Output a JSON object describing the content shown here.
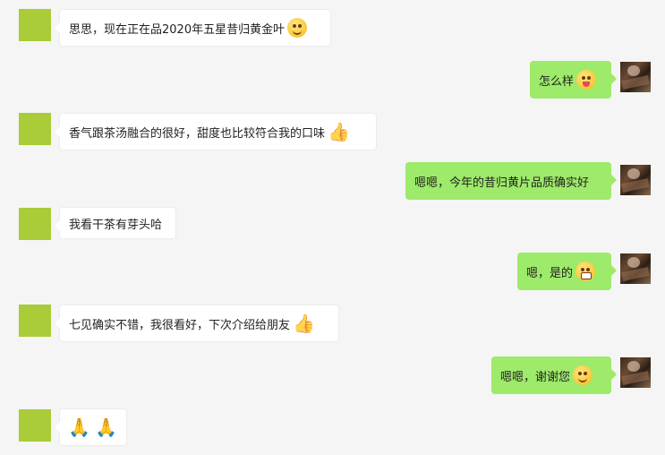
{
  "messages": [
    {
      "side": "left",
      "text": "思思，现在正在品2020年五星昔归黄金叶",
      "emoji": "thinking-face-icon"
    },
    {
      "side": "right",
      "text": "怎么样",
      "emoji": "crazy-face-icon"
    },
    {
      "side": "left",
      "text": "香气跟茶汤融合的很好，甜度也比较符合我的口味",
      "emoji": "thumbs-up-icon"
    },
    {
      "side": "right",
      "text": "嗯嗯，今年的昔归黄片品质确实好",
      "emoji": ""
    },
    {
      "side": "left",
      "text": "我看干茶有芽头哈",
      "emoji": ""
    },
    {
      "side": "right",
      "text": "嗯，是的",
      "emoji": "grin-face-icon"
    },
    {
      "side": "left",
      "text": "七见确实不错，我很看好，下次介绍给朋友",
      "emoji": "thumbs-up-icon"
    },
    {
      "side": "right",
      "text": "嗯嗯，谢谢您",
      "emoji": "smile-face-icon"
    },
    {
      "side": "left",
      "text": "",
      "emoji": "clap-hands-icon"
    }
  ],
  "colors": {
    "background": "#f5f5f5",
    "left_bubble": "#ffffff",
    "right_bubble": "#9eea6a",
    "left_avatar": "#a9cc38"
  },
  "glyphs": {
    "thumbs_up": "👍",
    "clap": "🙏"
  }
}
